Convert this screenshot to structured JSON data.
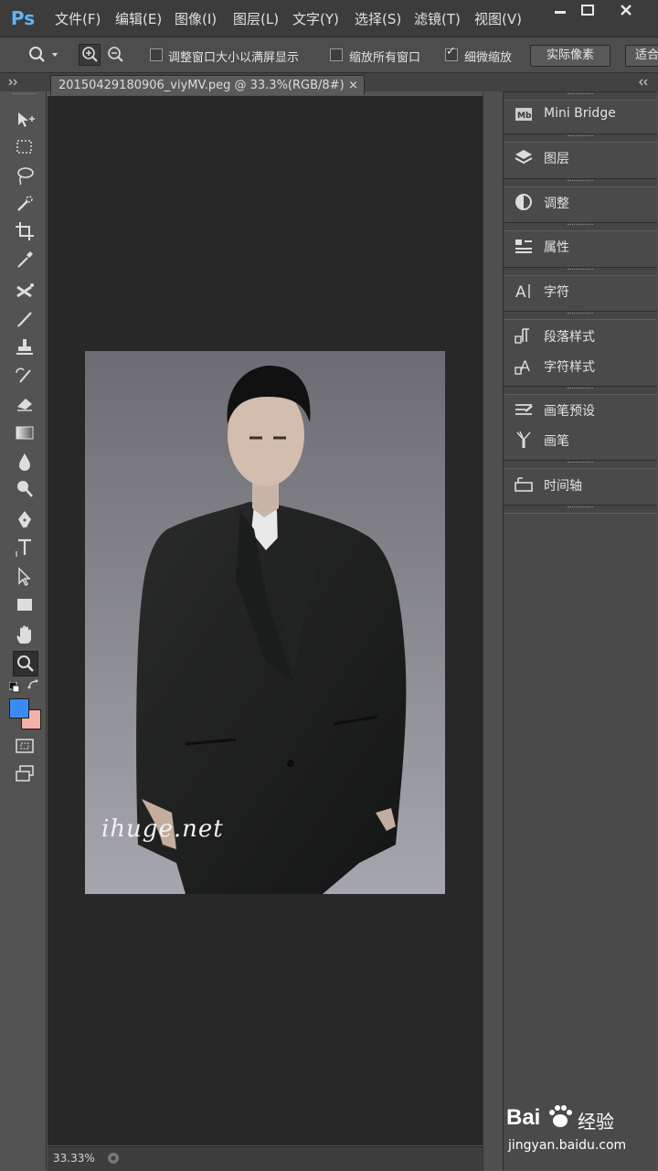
{
  "app": {
    "logo": "Ps",
    "menu": [
      "文件(F)",
      "编辑(E)",
      "图像(I)",
      "图层(L)",
      "文字(Y)",
      "选择(S)",
      "滤镜(T)",
      "视图(V)"
    ],
    "window_controls": [
      "minimize-icon",
      "maximize-icon",
      "close-icon"
    ]
  },
  "options": {
    "resize_windows_label": "调整窗口大小以满屏显示",
    "zoom_all_windows_label": "缩放所有窗口",
    "scrubby_zoom_label": "细微缩放",
    "scrubby_zoom_checked": true,
    "actual_pixels_button": "实际像素",
    "fit_screen_button": "适合"
  },
  "document": {
    "tab_title": "20150429180906_viyMV.peg @ 33.3%(RGB/8#)",
    "close_glyph": "×",
    "watermark_text": "ihuge.net",
    "zoom_status": "33.33%"
  },
  "tools": [
    "move-tool",
    "marquee-tool",
    "lasso-tool",
    "quick-selection-tool",
    "crop-tool",
    "eyedropper-tool",
    "spot-healing-tool",
    "brush-tool",
    "clone-stamp-tool",
    "history-brush-tool",
    "eraser-tool",
    "gradient-tool",
    "blur-tool",
    "dodge-tool",
    "pen-tool",
    "type-tool",
    "path-selection-tool",
    "rectangle-tool",
    "hand-tool",
    "zoom-tool"
  ],
  "colors": {
    "foreground": "#3b8cf2",
    "background": "#f2b1a4",
    "accent": "#5fb4f5"
  },
  "panels": [
    {
      "label": "Mini Bridge",
      "icon": "mini-bridge-icon"
    },
    {
      "label": "图层",
      "icon": "layers-icon"
    },
    {
      "label": "调整",
      "icon": "adjustments-icon"
    },
    {
      "label": "属性",
      "icon": "properties-icon"
    },
    {
      "label": "字符",
      "icon": "character-icon"
    },
    {
      "label": "段落样式",
      "icon": "paragraph-styles-icon"
    },
    {
      "label": "字符样式",
      "icon": "character-styles-icon"
    },
    {
      "label": "画笔预设",
      "icon": "brush-presets-icon"
    },
    {
      "label": "画笔",
      "icon": "brush-icon"
    },
    {
      "label": "时间轴",
      "icon": "timeline-icon"
    }
  ],
  "watermark": {
    "brand": "Bai",
    "brand2": "经验",
    "url": "jingyan.baidu.com"
  }
}
